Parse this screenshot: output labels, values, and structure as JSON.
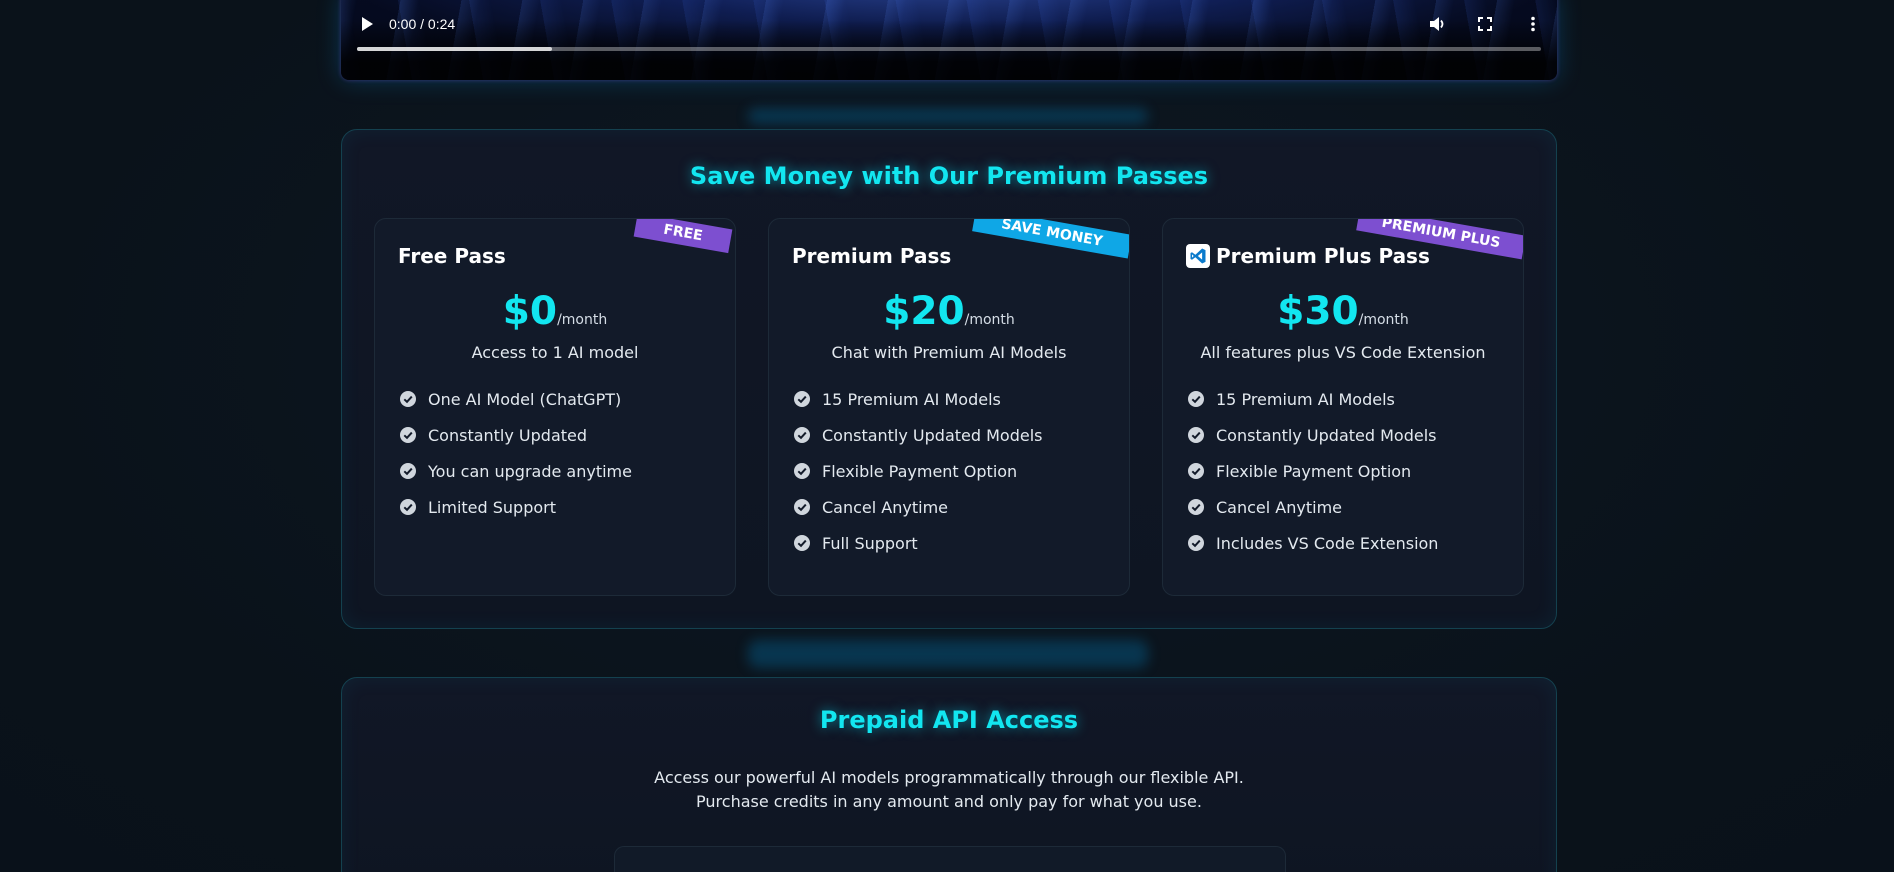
{
  "video": {
    "time": "0:00 / 0:24",
    "progress_fraction": 0.165
  },
  "passes": {
    "title": "Save Money with Our Premium Passes",
    "cards": [
      {
        "ribbon": "FREE",
        "name": "Free Pass",
        "price": "$0",
        "period": "/month",
        "description": "Access to 1 AI model",
        "features": [
          "One AI Model (ChatGPT)",
          "Constantly Updated",
          "You can upgrade anytime",
          "Limited Support"
        ]
      },
      {
        "ribbon": "SAVE MONEY",
        "name": "Premium Pass",
        "price": "$20",
        "period": "/month",
        "description": "Chat with Premium AI Models",
        "features": [
          "15 Premium AI Models",
          "Constantly Updated Models",
          "Flexible Payment Option",
          "Cancel Anytime",
          "Full Support"
        ]
      },
      {
        "ribbon": "PREMIUM PLUS",
        "name": "Premium Plus Pass",
        "price": "$30",
        "period": "/month",
        "description": "All features plus VS Code Extension",
        "features": [
          "15 Premium AI Models",
          "Constantly Updated Models",
          "Flexible Payment Option",
          "Cancel Anytime",
          "Includes VS Code Extension"
        ]
      }
    ]
  },
  "api": {
    "title": "Prepaid API Access",
    "description": "Access our powerful AI models programmatically through our flexible API. Purchase credits in any amount and only pay for what you use."
  },
  "colors": {
    "accent": "#12e6f0",
    "ribbon_purple": "#7d4fd0",
    "ribbon_blue": "#0fa7e6",
    "vscode_blue": "#0a7acc"
  },
  "icons": {
    "play": "play-icon",
    "volume": "volume-icon",
    "fullscreen": "fullscreen-icon",
    "more": "more-vertical-icon",
    "check": "check-circle-icon",
    "vscode": "vscode-icon"
  }
}
